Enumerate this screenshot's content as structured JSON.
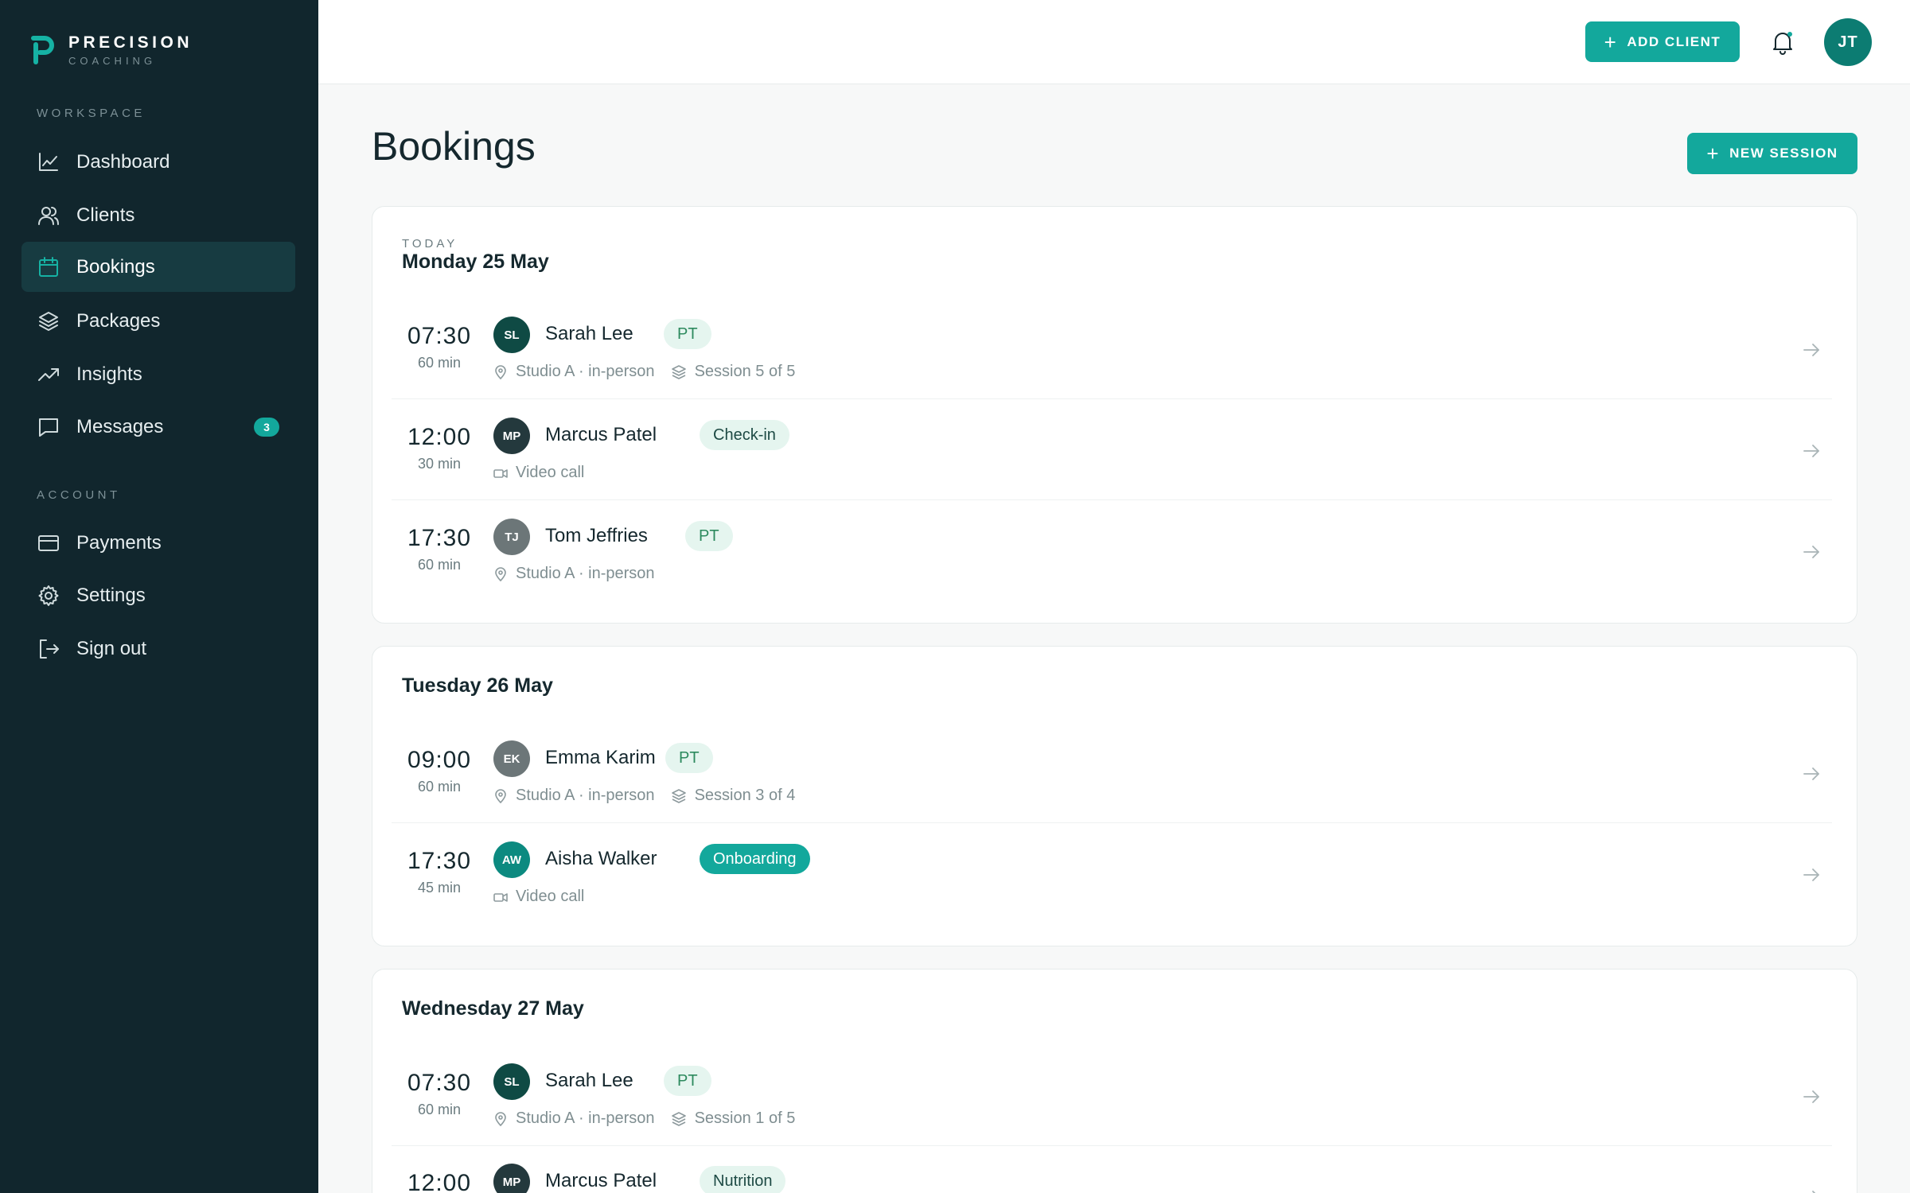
{
  "brand": {
    "title": "PRECISION",
    "subtitle": "COACHING"
  },
  "sidebar": {
    "workspace_label": "WORKSPACE",
    "account_label": "ACCOUNT",
    "workspace_items": [
      {
        "label": "Dashboard",
        "icon": "chart-line-icon"
      },
      {
        "label": "Clients",
        "icon": "users-icon"
      },
      {
        "label": "Bookings",
        "icon": "calendar-icon",
        "active": true
      },
      {
        "label": "Packages",
        "icon": "layers-icon"
      },
      {
        "label": "Insights",
        "icon": "trending-up-icon"
      },
      {
        "label": "Messages",
        "icon": "message-icon",
        "badge": "3"
      }
    ],
    "account_items": [
      {
        "label": "Payments",
        "icon": "credit-card-icon"
      },
      {
        "label": "Settings",
        "icon": "gear-icon"
      },
      {
        "label": "Sign out",
        "icon": "sign-out-icon"
      }
    ]
  },
  "topbar": {
    "add_client": "ADD CLIENT",
    "user_initials": "JT"
  },
  "page": {
    "title": "Bookings",
    "new_session": "NEW SESSION"
  },
  "days": [
    {
      "kicker": "TODAY",
      "title": "Monday 25 May",
      "sessions": [
        {
          "time": "07:30",
          "duration": "60 min",
          "initials": "SL",
          "name": "Sarah Lee",
          "tag": "PT",
          "location": "Studio A · in-person",
          "package": "Session 5 of 5"
        },
        {
          "time": "12:00",
          "duration": "30 min",
          "initials": "MP",
          "name": "Marcus Patel",
          "tag": "Check-in",
          "location": "Video call"
        },
        {
          "time": "17:30",
          "duration": "60 min",
          "initials": "TJ",
          "name": "Tom Jeffries",
          "tag": "PT",
          "location": "Studio A · in-person"
        }
      ]
    },
    {
      "title": "Tuesday 26 May",
      "sessions": [
        {
          "time": "09:00",
          "duration": "60 min",
          "initials": "EK",
          "name": "Emma Karim",
          "tag": "PT",
          "location": "Studio A · in-person",
          "package": "Session 3 of 4"
        },
        {
          "time": "17:30",
          "duration": "45 min",
          "initials": "AW",
          "name": "Aisha Walker",
          "tag": "Onboarding",
          "location": "Video call"
        }
      ]
    },
    {
      "title": "Wednesday 27 May",
      "sessions": [
        {
          "time": "07:30",
          "duration": "60 min",
          "initials": "SL",
          "name": "Sarah Lee",
          "tag": "PT",
          "location": "Studio A · in-person",
          "package": "Session 1 of 5"
        },
        {
          "time": "12:00",
          "initials": "MP",
          "name": "Marcus Patel",
          "tag": "Nutrition"
        }
      ]
    }
  ],
  "colors": {
    "sidebar_bg": "#11262d",
    "accent": "#13a89c",
    "avatar_sl": "#0f4a44",
    "avatar_mp": "#24393d",
    "avatar_tj": "#6c7678",
    "avatar_ek": "#6c7678",
    "avatar_aw": "#0c8a80"
  }
}
